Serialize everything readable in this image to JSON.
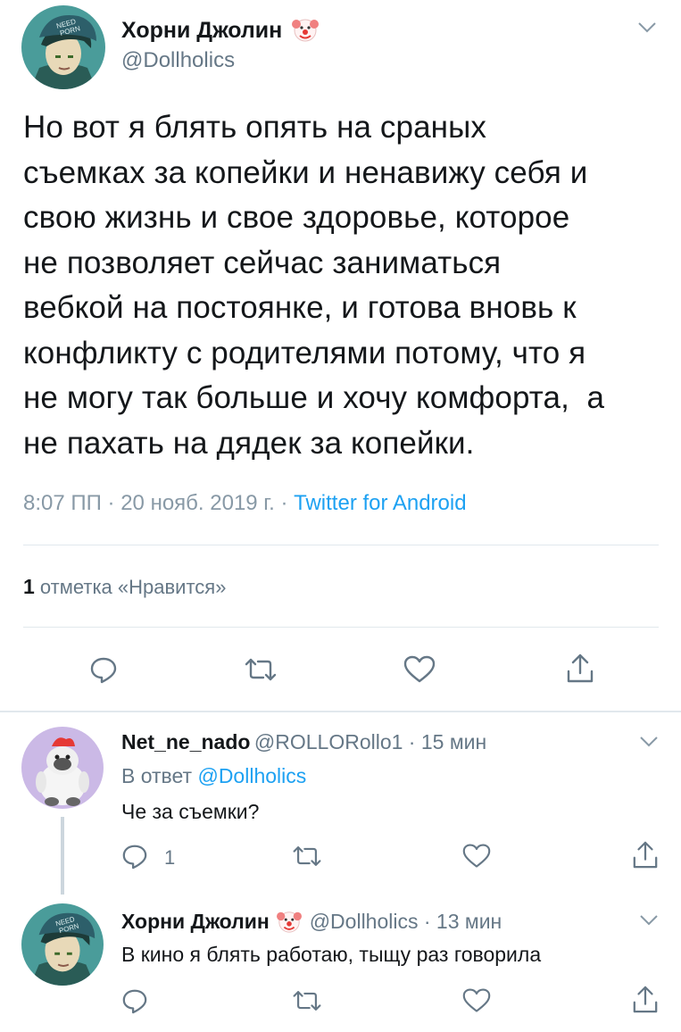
{
  "main_tweet": {
    "author_name": "Хорни Джолин",
    "author_handle": "@Dollholics",
    "text_lines": [
      "Но вот я блять опять на сраных",
      "съемках за копейки и ненавижу себя и",
      "свою жизнь и свое здоровье, которое",
      "не позволяет сейчас заниматься",
      "вебкой на постоянке, и готова вновь к",
      "конфликту с родителями потому, что я",
      "не могу так больше и хочу комфорта,  а",
      "не пахать на дядек за копейки."
    ],
    "timestamp": "8:07 ПП · 20 нояб. 2019 г. · ",
    "source": "Twitter for Android",
    "like_count": "1",
    "like_label": " отметка «Нравится»"
  },
  "replies": [
    {
      "author_name": "Net_ne_nado",
      "author_handle": "@ROLLORollo1",
      "time": " · 15 мин",
      "reply_to_prefix": "В ответ ",
      "reply_to_handle": "@Dollholics",
      "text": "Че за съемки?",
      "reply_count": "1"
    },
    {
      "author_name": "Хорни Джолин",
      "author_handle": "@Dollholics",
      "time": " · 13 мин",
      "text": "В кино я блять работаю, тыщу раз говорила"
    }
  ],
  "avatar_cap_text": [
    "NEED",
    "PORN"
  ],
  "colors": {
    "accent": "#1da1f2",
    "text": "#14171a",
    "secondary": "#657786",
    "divider": "#e1e8ed"
  }
}
